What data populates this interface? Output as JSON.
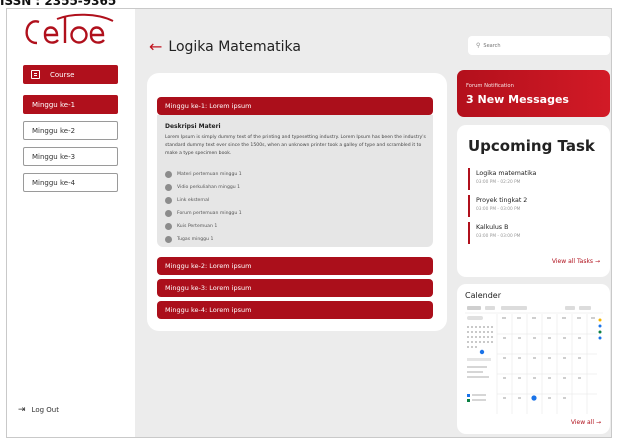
{
  "caption": "ISSN : 2355-9365",
  "logo_text": "celoe",
  "sidebar": {
    "course_label": "Course",
    "weeks": [
      "Minggu ke-1",
      "Minggu ke-2",
      "Minggu ke-3",
      "Minggu ke-4"
    ],
    "active_week": 0,
    "logout_label": "Log Out"
  },
  "header": {
    "title": "Logika Matematika",
    "search_placeholder": "Search"
  },
  "sections": [
    {
      "heading": "Minggu ke-1: Lorem ipsum",
      "expanded": true,
      "desc_title": "Deskripsi Materi",
      "desc_text": "Lorem Ipsum is simply dummy text of the printing and typesetting industry. Lorem Ipsum has been the industry's standard dummy text ever since the 1500s, when an unknown printer took a galley of type and scrambled it to make a type specimen book.",
      "items": [
        "Materi pertemuan minggu 1",
        "Vidio perkuliahan minggu 1",
        "Link eksternal",
        "Forum pertemuan minggu 1",
        "Kuis Pertemuan 1",
        "Tugas minggu 1"
      ]
    },
    {
      "heading": "Minggu ke-2: Lorem ipsum"
    },
    {
      "heading": "Minggu ke-3: Lorem ipsum"
    },
    {
      "heading": "Minggu ke-4: Lorem ipsum"
    }
  ],
  "notification": {
    "label": "Forum Notification",
    "count_text": "3 New Messages"
  },
  "upcoming": {
    "title": "Upcoming Task",
    "tasks": [
      {
        "name": "Logika matematika",
        "time": "03:00 PM - 02:20 PM"
      },
      {
        "name": "Proyek tingkat 2",
        "time": "03:00 PM - 03:00 PM"
      },
      {
        "name": "Kalkulus B",
        "time": "03:00 PM - 03:00 PM"
      }
    ],
    "view_all": "View all Tasks →"
  },
  "calendar": {
    "title": "Calender",
    "view_all": "View all →"
  },
  "colors": {
    "accent": "#b0101c",
    "background": "#ececec",
    "card": "#ffffff"
  }
}
